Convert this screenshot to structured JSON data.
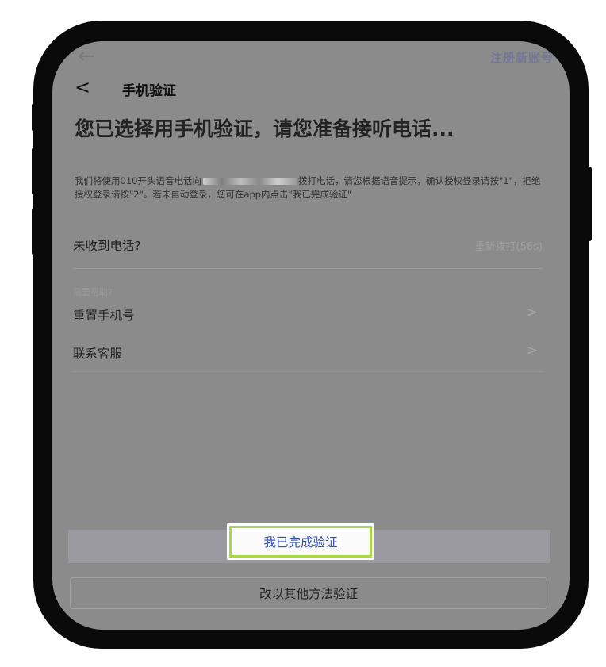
{
  "status": {
    "back_glyph": "←",
    "top_right_text": "注册新账号"
  },
  "navbar": {
    "back_glyph": "<",
    "title": "手机验证"
  },
  "headline": "您已选择用手机验证，请您准备接听电话...",
  "description": {
    "part1": "我们将使用010开头语音电话向",
    "part2": "拨打电话，请您根据语音提示，确认授权登录请按\"1\"，拒绝授权登录请按\"2\"。若未自动登录，您可在app内点击\"我已完成验证\""
  },
  "no_call": {
    "label": "未收到电话?",
    "redial": "重新拨打(56s)"
  },
  "help": {
    "label": "需要帮助?",
    "items": [
      {
        "label": "重置手机号",
        "chevron": ">"
      },
      {
        "label": "联系客服",
        "chevron": ">"
      }
    ]
  },
  "buttons": {
    "done": "我已完成验证",
    "other_method": "改以其他方法验证"
  },
  "colors": {
    "highlight_border": "#a8d84a",
    "done_text": "#2c52c8",
    "overlay": "#8b8b8b"
  }
}
